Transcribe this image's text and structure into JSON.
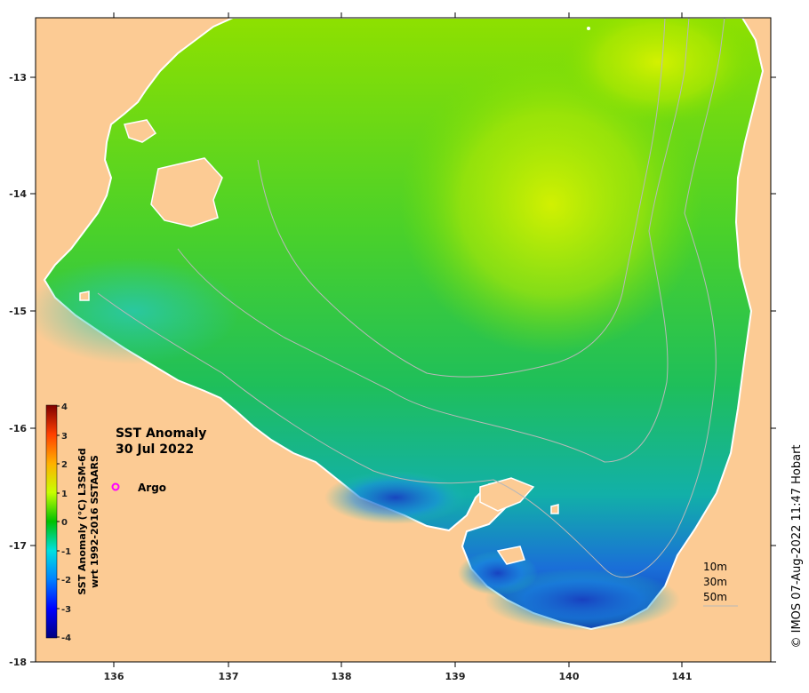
{
  "map": {
    "title_line1": "SST Anomaly",
    "title_line2": "30 Jul 2022",
    "legend_marker_label": "Argo",
    "legend_marker_color": "#ff00ff",
    "credit": "© IMOS 07-Aug-2022 11:47 Hobart",
    "colorbar_title_line1": "SST Anomaly (°C) L3SM-6d",
    "colorbar_title_line2": "wrt 1992-2016 SSTAARS",
    "colorbar_ticks": [
      "4",
      "3",
      "2",
      "1",
      "0",
      "-1",
      "-2",
      "-3",
      "-4"
    ],
    "x_ticks": [
      "136",
      "137",
      "138",
      "139",
      "140",
      "141"
    ],
    "y_ticks": [
      "-13",
      "-14",
      "-15",
      "-16",
      "-17",
      "-18"
    ],
    "contour_labels": [
      "10m",
      "30m",
      "50m"
    ],
    "land_color": "#fccb94",
    "colormap": [
      "#00007f",
      "#0000ff",
      "#0080ff",
      "#00ffff",
      "#00c800",
      "#80ff00",
      "#ffff00",
      "#ff8000",
      "#ff0000",
      "#7f0000"
    ]
  }
}
